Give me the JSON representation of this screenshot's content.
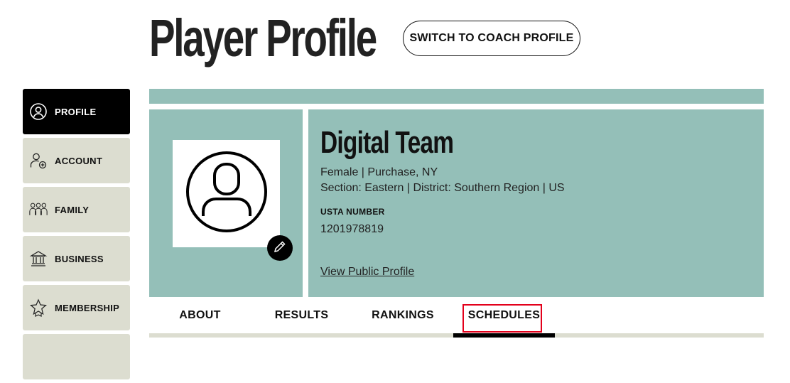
{
  "header": {
    "title": "Player Profile",
    "switch_label": "SWITCH TO COACH PROFILE"
  },
  "sidebar": {
    "items": [
      {
        "label": "PROFILE",
        "icon": "profile-icon",
        "active": true
      },
      {
        "label": "ACCOUNT",
        "icon": "add-user-icon",
        "active": false
      },
      {
        "label": "FAMILY",
        "icon": "family-icon",
        "active": false
      },
      {
        "label": "BUSINESS",
        "icon": "bank-icon",
        "active": false
      },
      {
        "label": "MEMBERSHIP",
        "icon": "star-badge-icon",
        "active": false
      }
    ]
  },
  "profile": {
    "name": "Digital Team",
    "gender_location": "Female | Purchase, NY",
    "section_district": "Section: Eastern | District: Southern Region | US",
    "usta_label": "USTA NUMBER",
    "usta_number": "1201978819",
    "view_public": "View Public Profile",
    "avatar_icon": "user-avatar-icon",
    "edit_icon": "pencil-icon"
  },
  "tabs": [
    {
      "label": "ABOUT",
      "active": false
    },
    {
      "label": "RESULTS",
      "active": false
    },
    {
      "label": "RANKINGS",
      "active": false
    },
    {
      "label": "SCHEDULES",
      "active": true
    }
  ],
  "colors": {
    "panel": "#94bfb8",
    "sidebar_bg": "#dcddd0",
    "active_bg": "#000000",
    "highlight": "#e3001b"
  }
}
